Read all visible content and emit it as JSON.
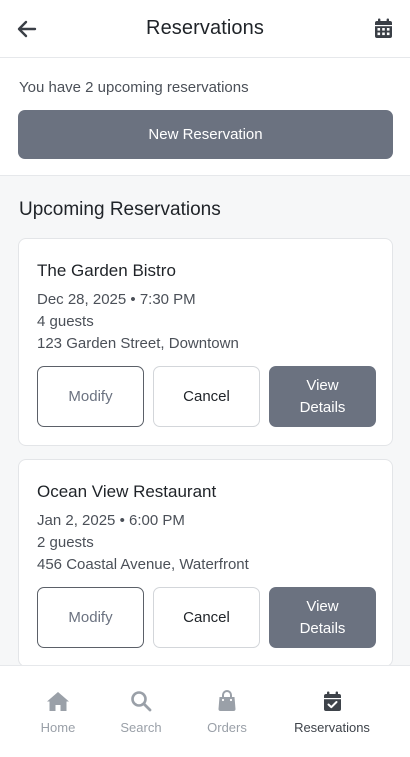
{
  "header": {
    "title": "Reservations",
    "back_icon": "arrow-left-icon",
    "calendar_icon": "calendar-icon"
  },
  "summary": {
    "count_text": "You have 2 upcoming reservations",
    "new_button": "New Reservation"
  },
  "section_title": "Upcoming Reservations",
  "reservations": [
    {
      "name": "The Garden Bistro",
      "when": "Dec 28, 2025 • 7:30 PM",
      "guests": "4 guests",
      "address": "123 Garden Street, Downtown",
      "modify": "Modify",
      "cancel": "Cancel",
      "view_line1": "View",
      "view_line2": "Details"
    },
    {
      "name": "Ocean View Restaurant",
      "when": "Jan 2, 2025 • 6:00 PM",
      "guests": "2 guests",
      "address": "456 Coastal Avenue, Waterfront",
      "modify": "Modify",
      "cancel": "Cancel",
      "view_line1": "View",
      "view_line2": "Details"
    }
  ],
  "nav": [
    {
      "label": "Home",
      "icon": "home-icon",
      "active": false
    },
    {
      "label": "Search",
      "icon": "search-icon",
      "active": false
    },
    {
      "label": "Orders",
      "icon": "shopping-bag-icon",
      "active": false
    },
    {
      "label": "Reservations",
      "icon": "calendar-check-icon",
      "active": true
    }
  ],
  "colors": {
    "primary": "#6b7280",
    "text": "#1f2328",
    "muted": "#9aa0a8",
    "active_nav": "#3e434a"
  }
}
